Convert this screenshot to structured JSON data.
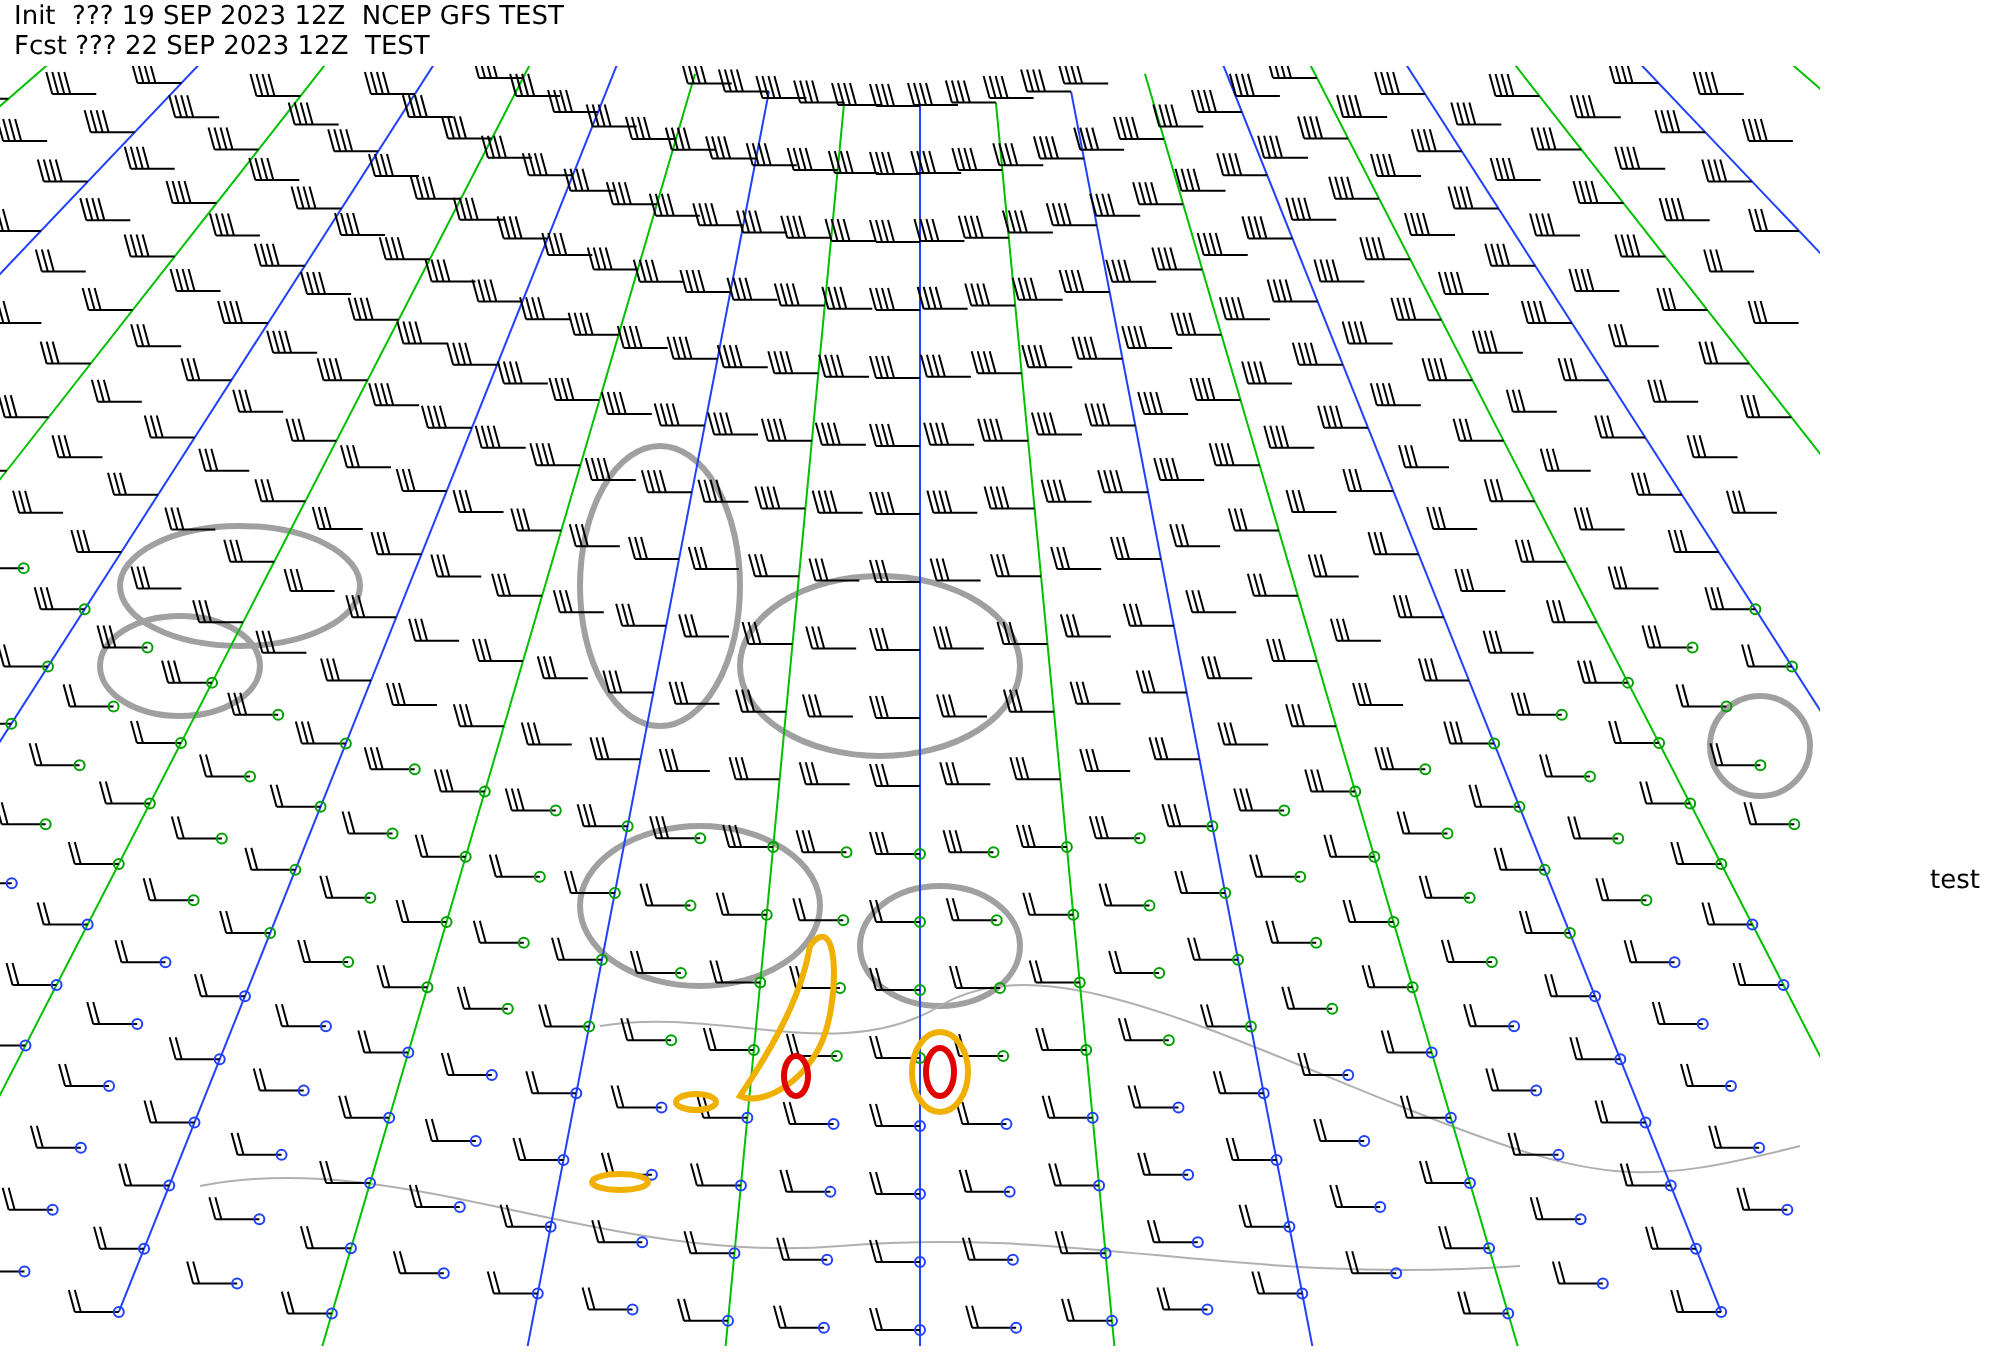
{
  "header": {
    "lines": [
      "Init  ??? 19 SEP 2023 12Z  NCEP GFS TEST",
      "Fcst ??? 22 SEP 2023 12Z  TEST"
    ]
  },
  "side_label": "test"
}
